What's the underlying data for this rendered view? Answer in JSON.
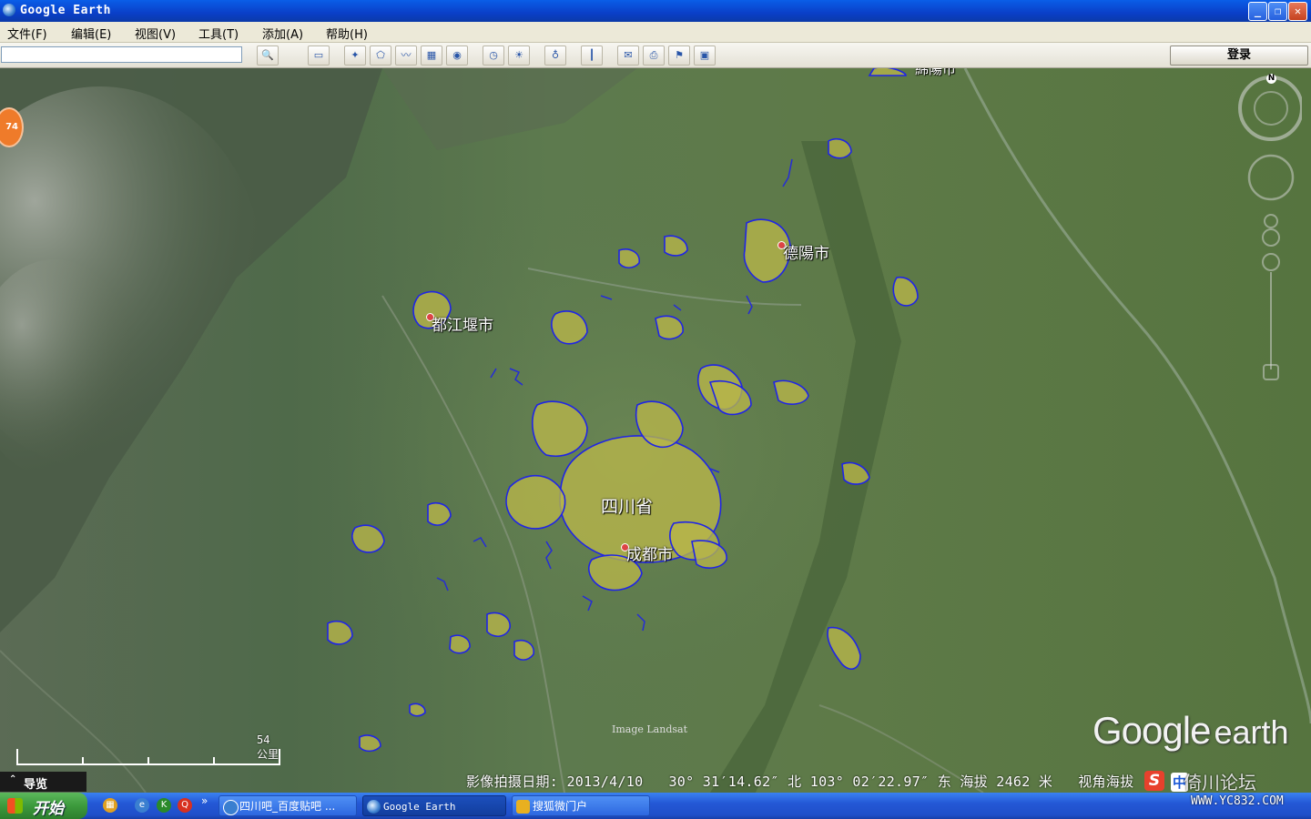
{
  "window": {
    "title": "Google Earth"
  },
  "menu": [
    {
      "label": "文件(F)"
    },
    {
      "label": "编辑(E)"
    },
    {
      "label": "视图(V)"
    },
    {
      "label": "工具(T)"
    },
    {
      "label": "添加(A)"
    },
    {
      "label": "帮助(H)"
    }
  ],
  "toolbar": {
    "search_value": "",
    "login_label": "登录"
  },
  "map": {
    "labels": {
      "deyang": "德陽市",
      "dujiangyan": "都江堰市",
      "sichuan": "四川省",
      "chengdu": "成都市",
      "mianyang": "綿陽市"
    },
    "image_credit": "Image Landsat",
    "scale_text": "54 公里",
    "status": {
      "date": "影像拍摄日期: 2013/4/10",
      "lat": "30° 31′14.62″ 北",
      "lon": "103° 02′22.97″ 东",
      "elev": "海拔  2462 米",
      "eye": "视角海拔"
    },
    "logo_google": "Google",
    "logo_earth": "earth",
    "compass_n": "N"
  },
  "left_badge": "74",
  "nav_panel": {
    "label": "导览"
  },
  "taskbar": {
    "start": "开始",
    "tasks": [
      {
        "label": "四川吧_百度贴吧 ..."
      },
      {
        "label": "Google Earth"
      },
      {
        "label": "搜狐微门户"
      }
    ]
  },
  "ime": {
    "s": "S",
    "zh": "中"
  },
  "watermark": {
    "text": "倚川论坛",
    "url": "WWW.YC832.COM"
  }
}
